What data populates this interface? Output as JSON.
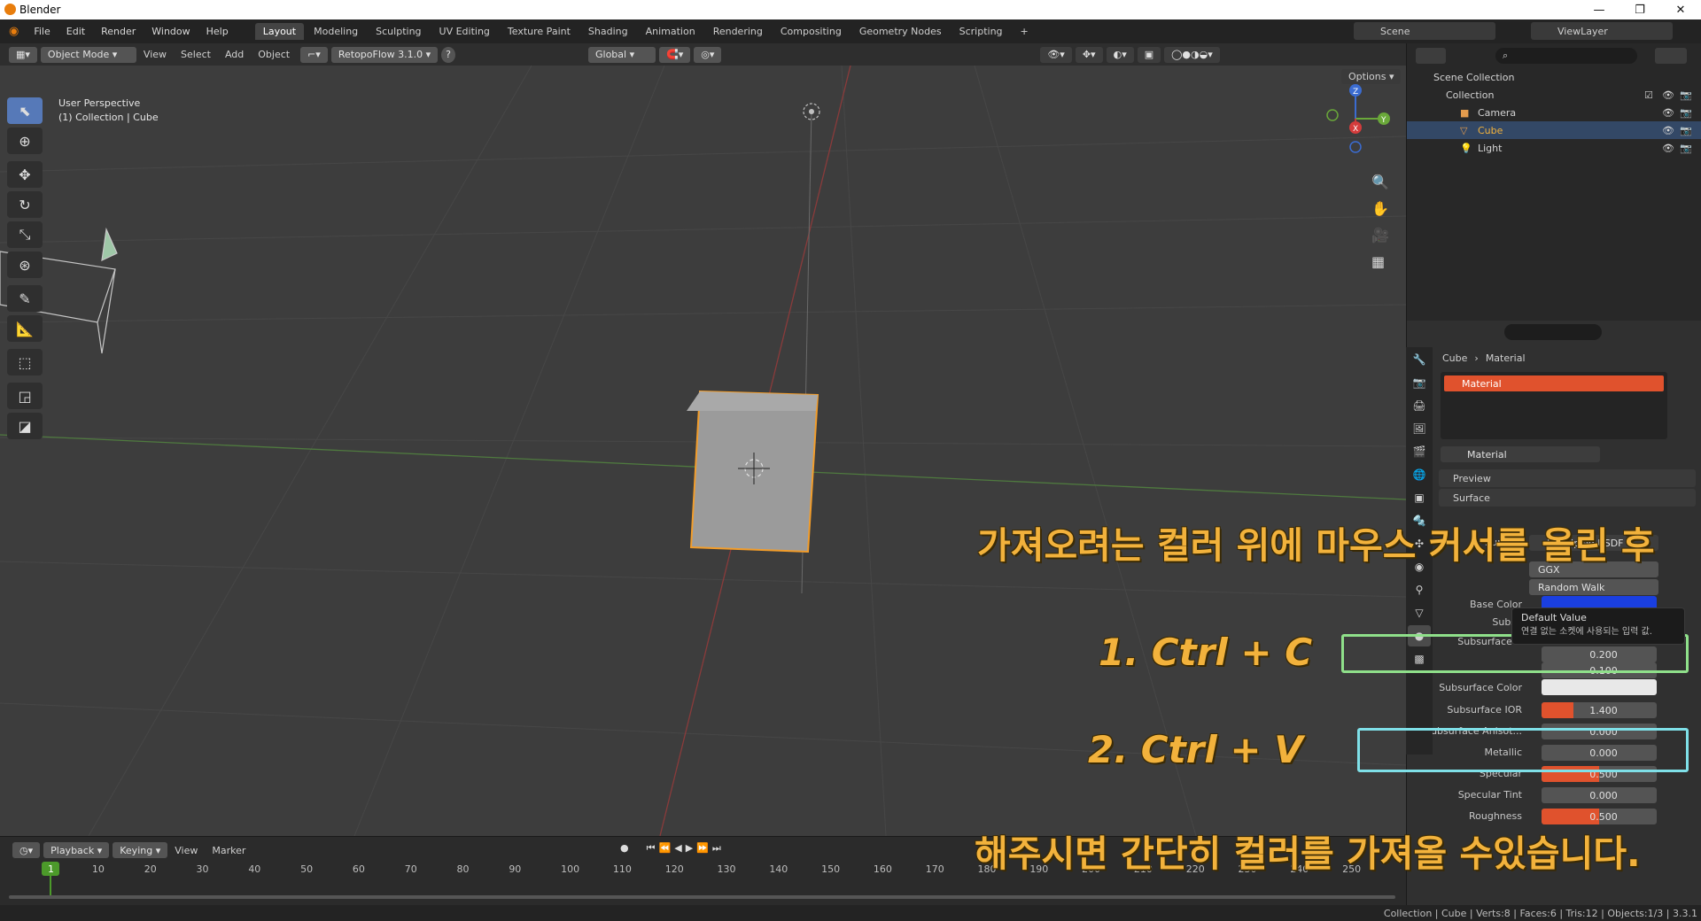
{
  "app": {
    "title": "Blender",
    "accent": "#e87d0d",
    "select_color": "#f29d2b",
    "highlight_color": "#e0522d"
  },
  "window_controls": {
    "minimize": "—",
    "restore": "❐",
    "close": "✕"
  },
  "menu": [
    "File",
    "Edit",
    "Render",
    "Window",
    "Help"
  ],
  "workspaces": [
    "Layout",
    "Modeling",
    "Sculpting",
    "UV Editing",
    "Texture Paint",
    "Shading",
    "Animation",
    "Rendering",
    "Compositing",
    "Geometry Nodes",
    "Scripting"
  ],
  "workspace_add": "+",
  "scene": {
    "scene_name": "Scene",
    "view_layer": "ViewLayer"
  },
  "viewport_header": {
    "mode": "Object Mode",
    "menus": [
      "View",
      "Select",
      "Add",
      "Object"
    ],
    "addon": "RetopoFlow 3.1.0",
    "help": "?",
    "orientation": "Global",
    "options": "Options"
  },
  "viewport": {
    "perspective": "User Perspective",
    "collection_info": "(1) Collection | Cube",
    "gizmo": {
      "x": "X",
      "y": "Y",
      "z": "Z"
    }
  },
  "outliner": {
    "search_placeholder": "",
    "root": "Scene Collection",
    "collection": "Collection",
    "items": [
      {
        "name": "Camera",
        "selected": false
      },
      {
        "name": "Cube",
        "selected": true
      },
      {
        "name": "Light",
        "selected": false
      }
    ]
  },
  "properties": {
    "breadcrumb_object": "Cube",
    "breadcrumb_separator": "›",
    "breadcrumb_material": "Material",
    "slot_name": "Material",
    "material_name": "Material",
    "panel_preview": "Preview",
    "panel_surface": "Surface",
    "surface_label": "Surface",
    "surface_value": "Principled BSDF",
    "distribution": "GGX",
    "subsurface_method": "Random Walk",
    "base_color_label": "Base Color",
    "base_color": "#1a3fe0",
    "subsurface_truncated": "Subsu",
    "subsurface_radius_label": "Subsurface R",
    "radius_values": [
      "0.200",
      "0.100"
    ],
    "subsurface_color_label": "Subsurface Color",
    "subsurface_color": "#e8e8e8",
    "rows": [
      {
        "label": "Subsurface IOR",
        "value": "1.400",
        "fill": 0.28
      },
      {
        "label": "Subsurface Anisot...",
        "value": "0.000",
        "fill": 0
      },
      {
        "label": "Metallic",
        "value": "0.000",
        "fill": 0
      },
      {
        "label": "Specular",
        "value": "0.500",
        "fill": 0.5
      },
      {
        "label": "Specular Tint",
        "value": "0.000",
        "fill": 0
      },
      {
        "label": "Roughness",
        "value": "0.500",
        "fill": 0.5
      }
    ],
    "tooltip_title": "Default Value",
    "tooltip_body": "연결 없는 소켓에 사용되는 입력 값."
  },
  "timeline": {
    "menus": [
      "Playback",
      "Keying",
      "View",
      "Marker"
    ],
    "current_frame": "1",
    "ticks": [
      "10",
      "20",
      "30",
      "40",
      "50",
      "60",
      "70",
      "80",
      "90",
      "100",
      "110",
      "120",
      "130",
      "140",
      "150",
      "160",
      "170",
      "180",
      "190",
      "200",
      "210",
      "220",
      "230",
      "240",
      "250"
    ]
  },
  "status": "Collection | Cube | Verts:8 | Faces:6 | Tris:12 | Objects:1/3 | 3.3.1",
  "annotations": {
    "top": "가져오려는 컬러 위에 마우스 커서를 올린 후",
    "step1": "1.    Ctrl + C",
    "step2": "2.    Ctrl + V",
    "bottom": "해주시면 간단히 컬러를 가져올 수있습니다."
  },
  "icons": [
    "blender-logo-icon",
    "eye-icon",
    "camera-icon",
    "cube-icon",
    "light-icon",
    "search-icon",
    "zoom-icon",
    "hand-icon",
    "grid-icon"
  ]
}
